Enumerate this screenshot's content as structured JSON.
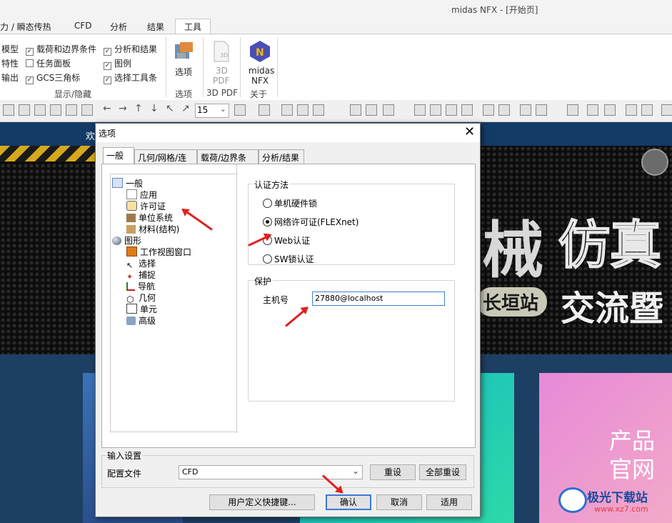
{
  "window": {
    "title": "midas NFX - [开始页]"
  },
  "ribbon": {
    "tabs": [
      "力 / 瞬态传热",
      "CFD",
      "分析",
      "结果",
      "工具"
    ],
    "active_tab": "工具",
    "left_labels": [
      "模型",
      "特性",
      "输出"
    ],
    "checks": [
      {
        "label": "载荷和边界条件",
        "checked": true
      },
      {
        "label": "任务面板",
        "checked": false
      },
      {
        "label": "GCS三角标",
        "checked": true
      },
      {
        "label": "分析和结果",
        "checked": true
      },
      {
        "label": "图例",
        "checked": true
      },
      {
        "label": "选择工具条",
        "checked": true
      }
    ],
    "group_show_hide": "显示/隐藏",
    "options_button": "选项",
    "group_options": "选项",
    "pdf_button_1": "3D",
    "pdf_button_2": "PDF",
    "group_pdf": "3D PDF",
    "about_button_1": "midas",
    "about_button_2": "NFX",
    "group_about": "关于"
  },
  "toolbar": {
    "zoom_value": "15"
  },
  "background": {
    "welcome": "欢",
    "banner_text_1": "械",
    "banner_text_2": "仿真",
    "banner_text_3": "长垣站",
    "banner_text_4": "交流暨",
    "card_text_1": "产品",
    "card_text_2": "官网",
    "watermark": "极光下载站",
    "watermark_url": "www.xz7.com"
  },
  "dialog": {
    "title": "选项",
    "tabs": [
      "一般",
      "几何/网格/连接",
      "载荷/边界条件",
      "分析/结果"
    ],
    "active_tab": "一般",
    "tree": [
      {
        "label": "一般",
        "level": 0,
        "icon": "general-icon"
      },
      {
        "label": "应用",
        "level": 1,
        "icon": "application-icon"
      },
      {
        "label": "许可证",
        "level": 1,
        "icon": "lock-icon"
      },
      {
        "label": "单位系统",
        "level": 1,
        "icon": "unit-icon"
      },
      {
        "label": "材料(结构)",
        "level": 1,
        "icon": "material-icon"
      },
      {
        "label": "图形",
        "level": 0,
        "icon": "graphics-icon"
      },
      {
        "label": "工作视图窗口",
        "level": 1,
        "icon": "view-window-icon"
      },
      {
        "label": "选择",
        "level": 1,
        "icon": "cursor-icon"
      },
      {
        "label": "捕捉",
        "level": 1,
        "icon": "snap-icon"
      },
      {
        "label": "导航",
        "level": 1,
        "icon": "axis-icon"
      },
      {
        "label": "几何",
        "level": 1,
        "icon": "cube-icon"
      },
      {
        "label": "单元",
        "level": 1,
        "icon": "element-icon"
      },
      {
        "label": "高级",
        "level": 1,
        "icon": "advanced-icon"
      }
    ],
    "auth_group": "认证方法",
    "auth_options": [
      {
        "label": "单机硬件锁",
        "selected": false
      },
      {
        "label": "网络许可证(FLEXnet)",
        "selected": true
      },
      {
        "label": "Web认证",
        "selected": false
      },
      {
        "label": "SW锁认证",
        "selected": false
      }
    ],
    "protect_group": "保护",
    "host_label": "主机号",
    "host_value": "27880@localhost",
    "input_group": "输入设置",
    "config_label": "配置文件",
    "config_value": "CFD",
    "reset_button": "重设",
    "reset_all_button": "全部重设",
    "shortcut_button": "用户定义快捷键...",
    "ok_button": "确认",
    "cancel_button": "取消",
    "apply_button": "适用"
  }
}
